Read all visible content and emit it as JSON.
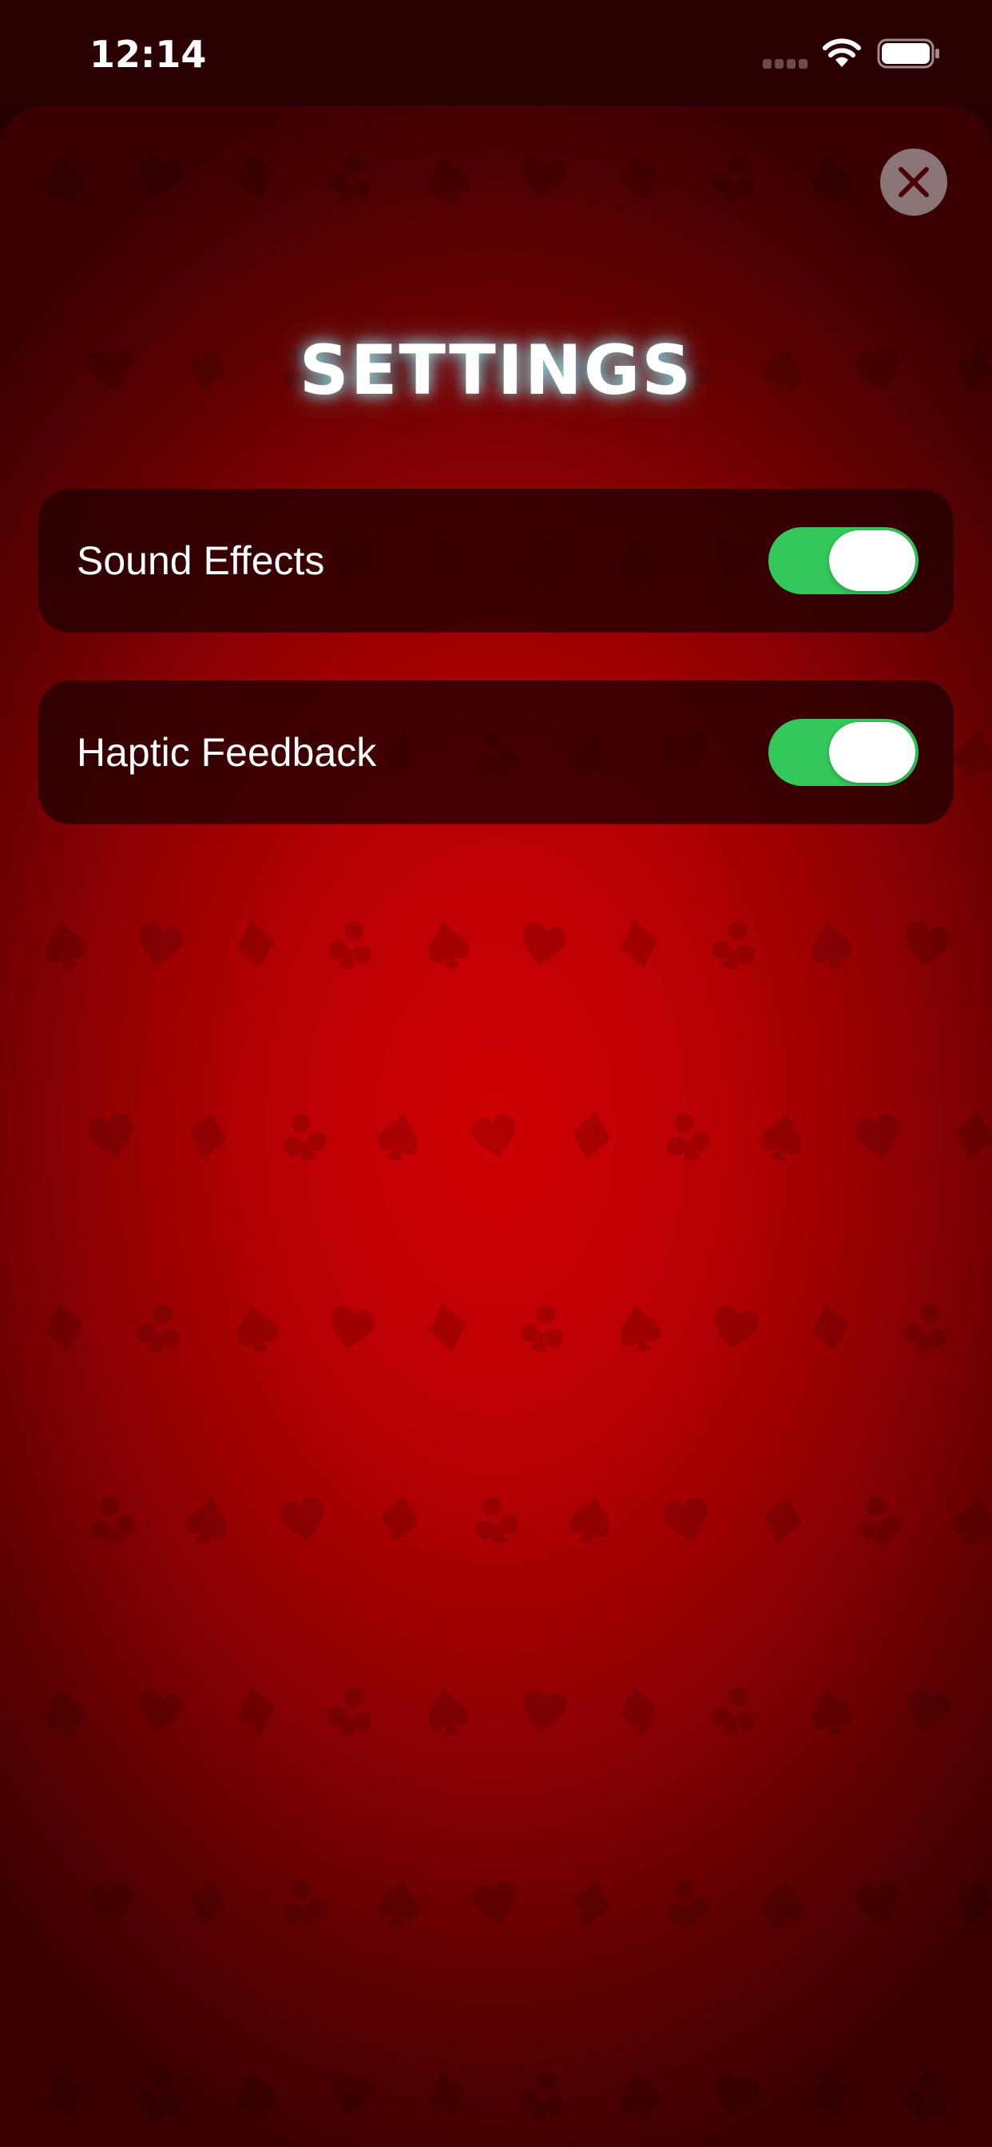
{
  "status_bar": {
    "time": "12:14",
    "cellular_icon": "cell-signal-dots",
    "wifi_icon": "wifi",
    "battery_icon": "battery-full"
  },
  "header": {
    "close_icon": "close-x",
    "title": "SETTINGS"
  },
  "settings": [
    {
      "label": "Sound Effects",
      "enabled": true
    },
    {
      "label": "Haptic Feedback",
      "enabled": true
    }
  ],
  "background": {
    "pattern": "playing-card-suits",
    "suits": [
      "spade",
      "heart",
      "diamond",
      "club"
    ]
  },
  "colors": {
    "background_center": "#cf0003",
    "background_edge": "#3a0002",
    "toggle_on": "#34c759",
    "title_glow": "#8ce6f0",
    "row_background": "#230002"
  }
}
